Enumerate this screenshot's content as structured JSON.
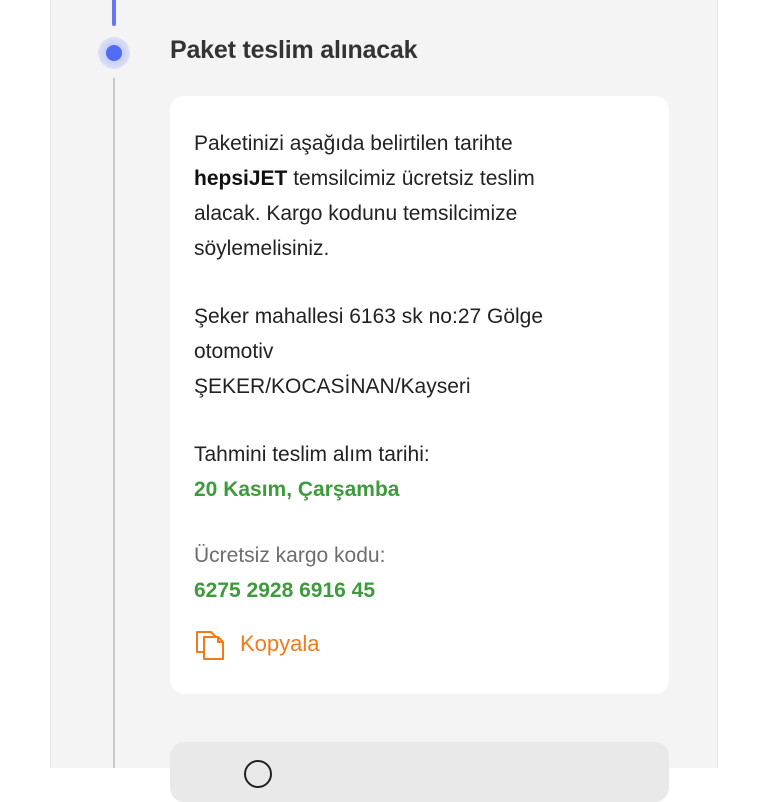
{
  "step": {
    "title": "Paket teslim alınacak"
  },
  "card": {
    "intro_line1": "Paketinizi aşağıda belirtilen tarihte",
    "intro_brand": "hepsiJET",
    "intro_line2_rest": " temsilcimiz ücretsiz teslim",
    "intro_line3": "alacak. Kargo kodunu temsilcimize",
    "intro_line4": "söylemelisiniz.",
    "address_line1": "Şeker mahallesi 6163 sk no:27 Gölge",
    "address_line2": "otomotiv",
    "address_line3": "ŞEKER/KOCASİNAN/Kayseri",
    "pickup_date_label": "Tahmini teslim alım tarihi:",
    "pickup_date_value": "20 Kasım, Çarşamba",
    "cargo_code_label": "Ücretsiz kargo kodu:",
    "cargo_code_value": "6275 2928 6916 45",
    "copy_label": "Kopyala"
  },
  "colors": {
    "accent_blue": "#4f6cf2",
    "success_green": "#3e9b3c",
    "action_orange": "#f27a1a"
  },
  "icons": {
    "copy": "copy-icon",
    "next_step": "circle-icon"
  }
}
